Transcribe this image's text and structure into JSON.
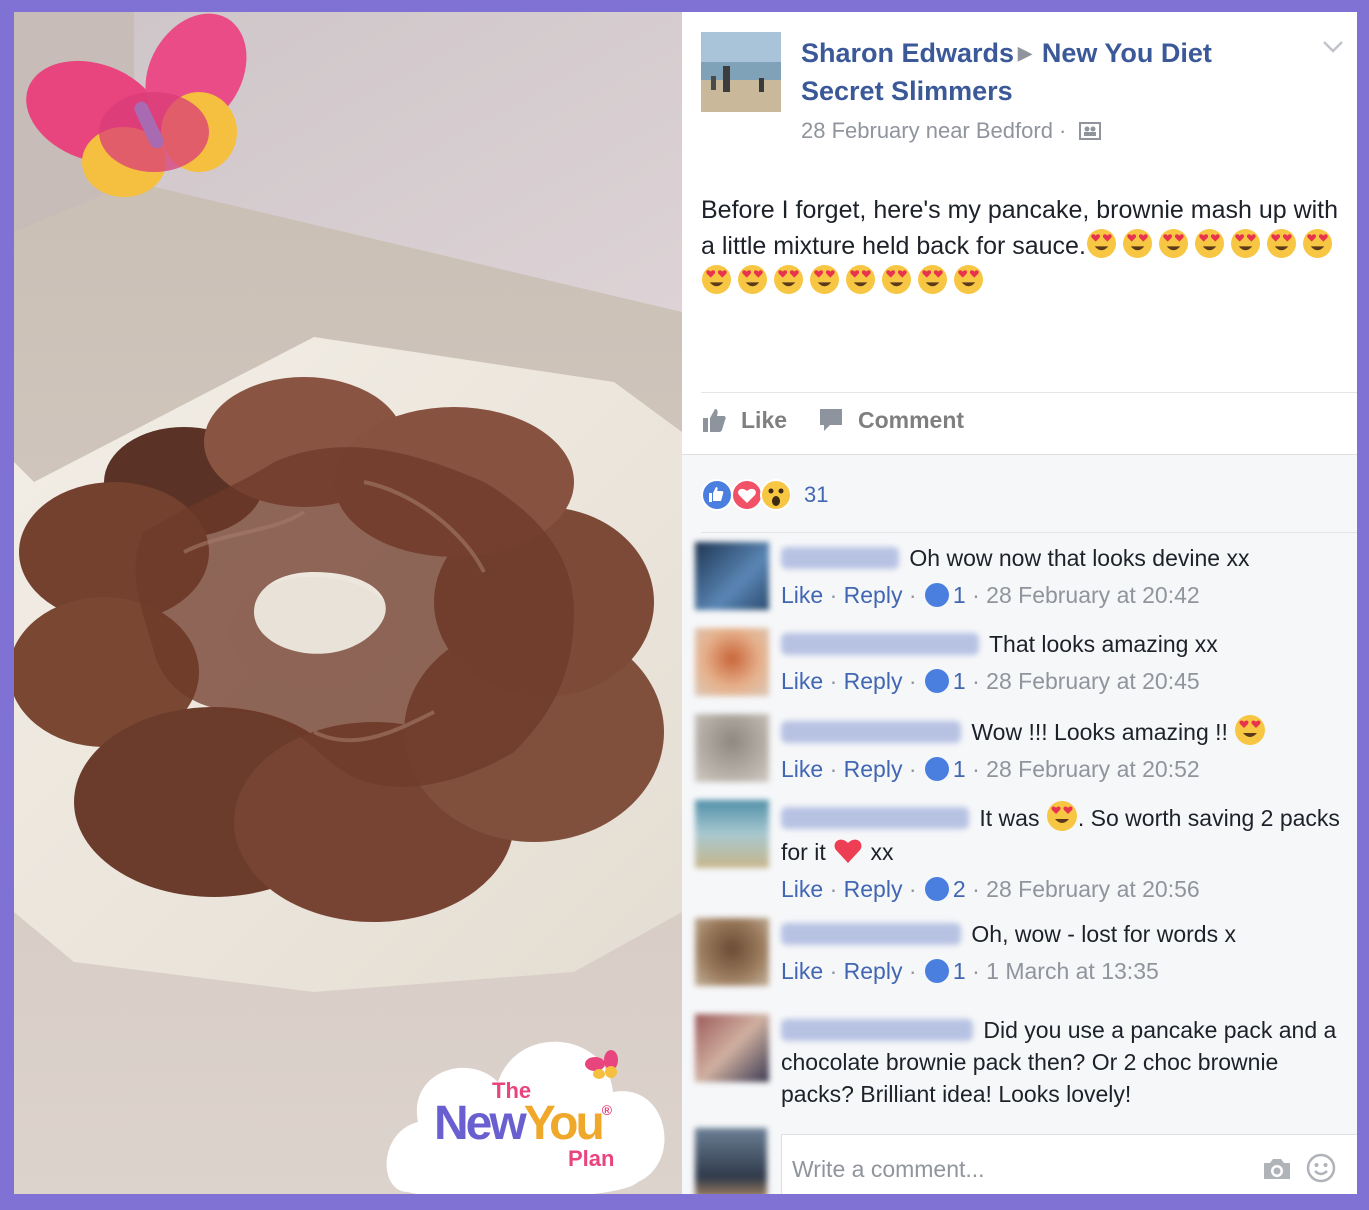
{
  "post": {
    "author": "Sharon Edwards",
    "group": "New You Diet Secret Slimmers",
    "meta": "28 February near Bedford ·",
    "text": "Before I forget, here's my pancake, brownie mash up with a little mixture held back for sauce."
  },
  "actions": {
    "like_label": "Like",
    "comment_label": "Comment"
  },
  "reactions": {
    "count": "31"
  },
  "comments": [
    {
      "text": "Oh wow now that looks devine xx",
      "like": "Like",
      "reply": "Reply",
      "likes": "1",
      "time": "28 February at 20:42"
    },
    {
      "text": "That looks amazing xx",
      "like": "Like",
      "reply": "Reply",
      "likes": "1",
      "time": "28 February at 20:45"
    },
    {
      "text": "Wow !!! Looks amazing !!",
      "like": "Like",
      "reply": "Reply",
      "likes": "1",
      "time": "28 February at 20:52"
    },
    {
      "text_a": "It was",
      "text_b": ". So worth saving 2 packs for it",
      "text_c": "xx",
      "like": "Like",
      "reply": "Reply",
      "likes": "2",
      "time": "28 February at 20:56"
    },
    {
      "text": "Oh, wow - lost for words x",
      "like": "Like",
      "reply": "Reply",
      "likes": "1",
      "time": "1 March at 13:35"
    },
    {
      "text": "Did you use a pancake pack and a chocolate brownie pack then? Or 2 choc brownie packs? Brilliant idea! Looks lovely!"
    }
  ],
  "write_comment": {
    "placeholder": "Write a comment..."
  },
  "logo": {
    "line1": "The",
    "line2a": "New",
    "line2b": "You",
    "line3": "Plan",
    "reg": "®"
  }
}
